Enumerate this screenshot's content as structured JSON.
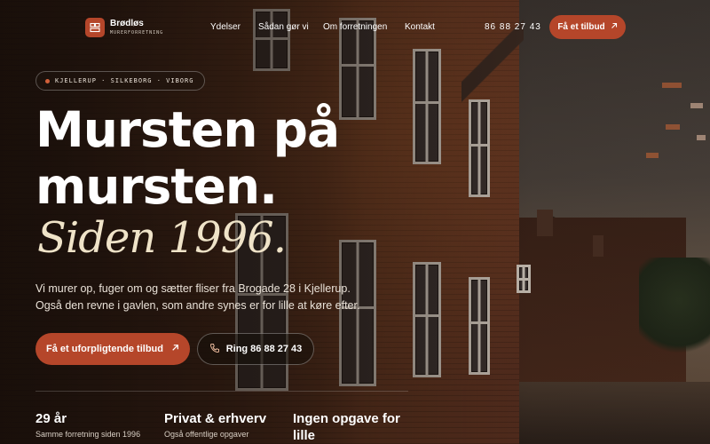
{
  "brand": {
    "name": "Brødløs",
    "tagline": "MURERFORRETNING",
    "accent": "#b5462a"
  },
  "nav": {
    "items": [
      {
        "label": "Ydelser"
      },
      {
        "label": "Sådan gør vi"
      },
      {
        "label": "Om forretningen"
      },
      {
        "label": "Kontakt"
      }
    ],
    "phone": "86 88 27 43",
    "cta_label": "Få et tilbud"
  },
  "hero": {
    "locations": "KJELLERUP · SILKEBORG · VIBORG",
    "headline_line1": "Mursten på",
    "headline_line2": "mursten.",
    "headline_italic": "Siden 1996.",
    "lead_line1": "Vi murer op, fuger om og sætter fliser fra Brogade 28 i Kjellerup.",
    "lead_line2": "Også den revne i gavlen, som andre synes er for lille at køre efter.",
    "primary_cta": "Få et uforpligtende tilbud",
    "secondary_cta": "Ring 86 88 27 43"
  },
  "stats": [
    {
      "title": "29 år",
      "subtitle": "Samme forretning siden 1996"
    },
    {
      "title": "Privat & erhverv",
      "subtitle": "Også offentlige opgaver"
    },
    {
      "title": "Ingen opgave for lille",
      "subtitle": ""
    }
  ],
  "icons": {
    "arrow": "arrow-up-right-icon",
    "phone": "phone-icon",
    "logo": "brick-logo-icon"
  }
}
